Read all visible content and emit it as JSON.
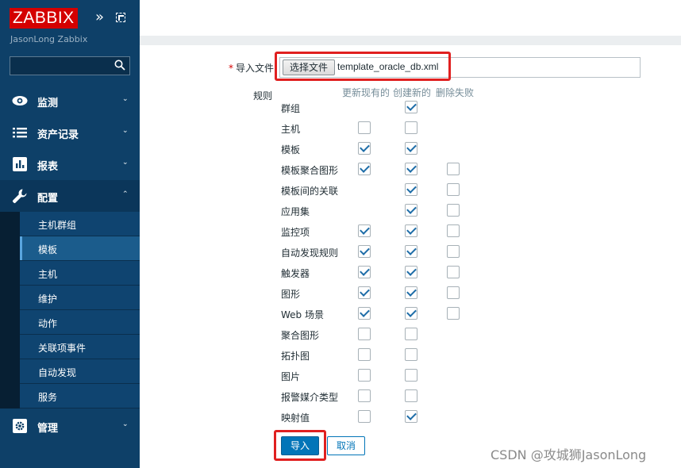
{
  "sidebar": {
    "logo": "ZABBIX",
    "server_name": "JasonLong Zabbix",
    "search": {
      "placeholder": "",
      "value": ""
    },
    "menu": [
      {
        "label": "监测",
        "icon": "eye-icon",
        "expanded": false
      },
      {
        "label": "资产记录",
        "icon": "list-icon",
        "expanded": false
      },
      {
        "label": "报表",
        "icon": "bar-chart-icon",
        "expanded": false
      },
      {
        "label": "配置",
        "icon": "wrench-icon",
        "expanded": true
      },
      {
        "label": "管理",
        "icon": "gear-icon",
        "expanded": false
      }
    ],
    "submenu": [
      {
        "label": "主机群组",
        "selected": false
      },
      {
        "label": "模板",
        "selected": true
      },
      {
        "label": "主机",
        "selected": false
      },
      {
        "label": "维护",
        "selected": false
      },
      {
        "label": "动作",
        "selected": false
      },
      {
        "label": "关联项事件",
        "selected": false
      },
      {
        "label": "自动发现",
        "selected": false
      },
      {
        "label": "服务",
        "selected": false
      }
    ]
  },
  "form": {
    "import_file_label": "导入文件",
    "required_mark": "*",
    "choose_file_button": "选择文件",
    "file_name": "template_oracle_db.xml",
    "rules_label": "规则",
    "columns": [
      "更新现有的",
      "创建新的",
      "删除失败"
    ],
    "rules": [
      {
        "name": "群组",
        "update": null,
        "create": true,
        "delete": null
      },
      {
        "name": "主机",
        "update": false,
        "create": false,
        "delete": null
      },
      {
        "name": "模板",
        "update": true,
        "create": true,
        "delete": null
      },
      {
        "name": "模板聚合图形",
        "update": true,
        "create": true,
        "delete": false
      },
      {
        "name": "模板间的关联",
        "update": null,
        "create": true,
        "delete": false
      },
      {
        "name": "应用集",
        "update": null,
        "create": true,
        "delete": false
      },
      {
        "name": "监控项",
        "update": true,
        "create": true,
        "delete": false
      },
      {
        "name": "自动发现规则",
        "update": true,
        "create": true,
        "delete": false
      },
      {
        "name": "触发器",
        "update": true,
        "create": true,
        "delete": false
      },
      {
        "name": "图形",
        "update": true,
        "create": true,
        "delete": false
      },
      {
        "name": "Web 场景",
        "update": true,
        "create": true,
        "delete": false
      },
      {
        "name": "聚合图形",
        "update": false,
        "create": false,
        "delete": null
      },
      {
        "name": "拓扑图",
        "update": false,
        "create": false,
        "delete": null
      },
      {
        "name": "图片",
        "update": false,
        "create": false,
        "delete": null
      },
      {
        "name": "报警媒介类型",
        "update": false,
        "create": false,
        "delete": null
      },
      {
        "name": "映射值",
        "update": false,
        "create": true,
        "delete": null
      }
    ],
    "import_button": "导入",
    "cancel_button": "取消"
  },
  "watermark": "CSDN @攻城狮JasonLong",
  "colors": {
    "sidebar_bg": "#0e4068",
    "logo_red": "#d40000",
    "accent_blue": "#0275b8",
    "highlight_red": "#e02020"
  }
}
